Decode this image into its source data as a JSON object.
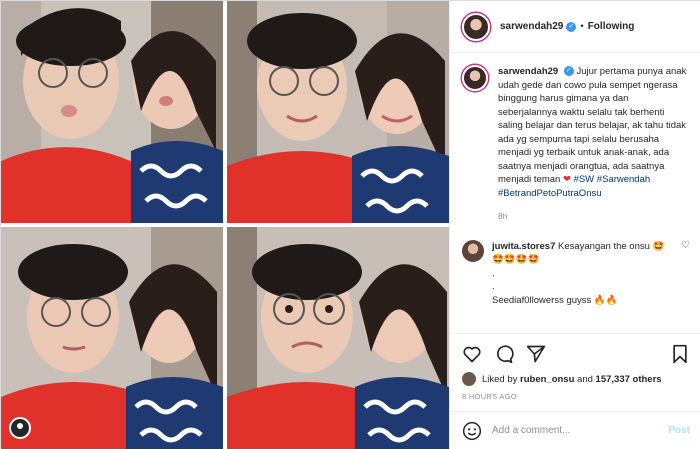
{
  "header": {
    "username": "sarwendah29",
    "separator": "•",
    "follow_label": "Following"
  },
  "caption": {
    "username": "sarwendah29",
    "text": "Jujur pertama punya anak udah gede dan cowo pula sempet ngerasa binggung harus gimana ya dan seberjalannya waktu selalu tak berhenti saling belajar dan terus belajar, ak tahu tidak ada yg sempurna tapi selalu berusaha menjadi yg terbaik untuk anak-anak, ada saatnya menjadi orangtua, ada saatnya menjadi teman",
    "heart": "❤",
    "tag1": "#SW",
    "tag2": "#Sarwendah",
    "tag3": "#BetrandPetoPutraOnsu",
    "time": "8h"
  },
  "reply": {
    "username": "juwita.stores7",
    "text": "Kesayangan the onsu 🤩🤩🤩🤩🤩",
    "dot1": ".",
    "dot2": ".",
    "text2": "Seediaf0llowerss guyss 🔥🔥"
  },
  "likes": {
    "prefix": "Liked by",
    "user": "ruben_onsu",
    "connector": "and",
    "count": "157,337 others"
  },
  "time_ago": "8 HOURS AGO",
  "add_comment": {
    "placeholder": "Add a comment...",
    "post_label": "Post"
  },
  "icons": {
    "like": "heart-icon",
    "comment": "comment-icon",
    "share": "share-icon",
    "save": "bookmark-icon",
    "emoji": "emoji-icon"
  },
  "colors": {
    "link": "#00376b",
    "post_disabled": "#b2dffc",
    "verified": "#3897f0",
    "story_ring": "#c13584",
    "shirt_red": "#e0322b"
  }
}
